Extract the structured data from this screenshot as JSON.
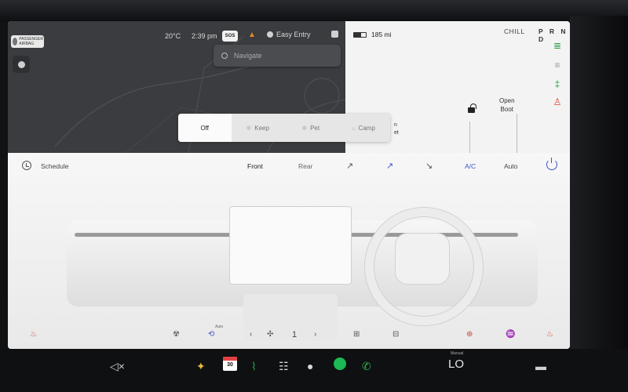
{
  "map": {
    "badge_text": "PASSENGER AIRBAG",
    "temperature": "20°C",
    "time": "2:39 pm",
    "sos_label": "SOS",
    "profile_name": "Easy Entry",
    "search_placeholder": "Navigate"
  },
  "car": {
    "range": "185 mi",
    "drive_mode": "CHILL",
    "gear_selector": "P R N D",
    "open_boot": "Open\nBoot",
    "car_edge_text": "n\net"
  },
  "modes": [
    {
      "label": "Off",
      "icon": ""
    },
    {
      "label": "Keep",
      "icon": "fan-icon"
    },
    {
      "label": "Pet",
      "icon": "paw-icon"
    },
    {
      "label": "Camp",
      "icon": "tent-icon"
    }
  ],
  "climate": {
    "schedule_label": "Schedule",
    "front_label": "Front",
    "rear_label": "Rear",
    "ac_label": "A/C",
    "auto_label": "Auto",
    "fan_speed": "1",
    "auto_small": "Auto"
  },
  "dock": {
    "calendar_day": "30",
    "temp_label": "LO",
    "manual_label": "Manual"
  },
  "colors": {
    "accent_blue": "#3a55c8",
    "heat_red": "#d6453a",
    "spotify_green": "#1db954"
  }
}
